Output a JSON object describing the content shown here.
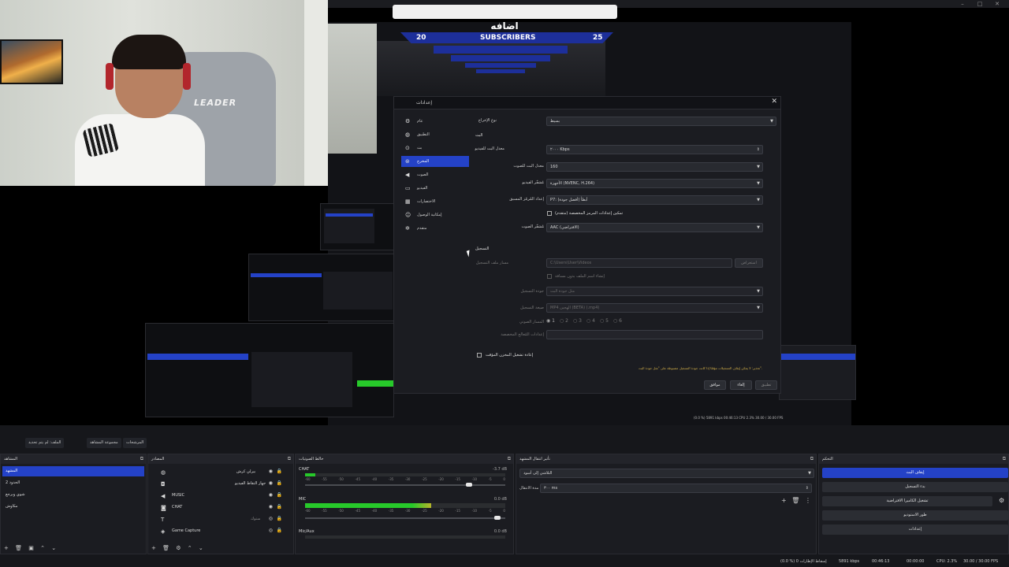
{
  "stream_overlay": {
    "banner_text": "اضافه",
    "count_left": "20",
    "count_right": "25",
    "label": "SUBSCRIBERS"
  },
  "webcam": {
    "chair_logo": "LEADER"
  },
  "settings_dialog": {
    "title": "إعدادات",
    "sidebar": [
      {
        "label": "عام",
        "icon": "gear-icon"
      },
      {
        "label": "التطبيق",
        "icon": "globe-icon"
      },
      {
        "label": "بث",
        "icon": "antenna-icon"
      },
      {
        "label": "المخرج",
        "icon": "output-icon",
        "selected": true
      },
      {
        "label": "الصوت",
        "icon": "speaker-icon"
      },
      {
        "label": "الفيديو",
        "icon": "monitor-icon"
      },
      {
        "label": "الاختصارات",
        "icon": "keyboard-icon"
      },
      {
        "label": "إمكانية الوصول",
        "icon": "accessibility-icon"
      },
      {
        "label": "متقدم",
        "icon": "tools-icon"
      }
    ],
    "output_mode_label": "نوع الإخراج",
    "output_mode_value": "بسيط",
    "streaming_section": "البث",
    "video_bitrate_label": "معدل البت للفيديو",
    "video_bitrate_value": "۲۰۰۰ Kbps",
    "audio_bitrate_label": "معدل البت للصوت",
    "audio_bitrate_value": "160",
    "encoder_label": "مُشفّر الفيديو",
    "encoder_value": "الأجهزة (NVENC, H.264)",
    "preset_label": "إعداد المُرمّز المسبق",
    "preset_value": "P7: أبطأ (أفضل جودة)",
    "custom_encoder_label": "تمكين إعدادات المرمز المخصصة (متقدم)",
    "audio_encoder_label": "مُشفّر الصوت",
    "audio_encoder_value": "AAC (الافتراضي)",
    "recording_section": "التسجيل",
    "recording_path_label": "مسار ملف التسجيل",
    "recording_path_value": "C:\\Users\\User\\Videos",
    "browse_button": "استعراض",
    "no_space_label": "إنشاء اسم الملف بدون مسافة",
    "recording_quality_label": "جودة التسجيل",
    "recording_quality_value": "مثل جودة البث",
    "recording_format_label": "صيغة التسجيل",
    "recording_format_value": "MP4 الهجين (BETA) (.mp4)",
    "audio_track_label": "المسار الصوتي",
    "audio_tracks": [
      "1",
      "2",
      "3",
      "4",
      "5",
      "6"
    ],
    "muxer_label": "إعدادات المُعالج المخصصة",
    "replay_buffer_label": "إعادة تشغيل المخزن المؤقت",
    "warning": "تحذير: لا يمكن إيقاف التسجيلات مؤقتًا إذا كانت جودة التسجيل مضبوطة على \"مثل جودة البث\".",
    "buttons": {
      "ok": "موافق",
      "cancel": "إلغاء",
      "apply": "تطبيق"
    }
  },
  "toolbar": {
    "profile": "الملف: لم يتم تحديد",
    "scene_collection": "مجموعة المشاهد",
    "filters": "المرشحات"
  },
  "scenes_dock": {
    "title": "المشاهد",
    "items": [
      {
        "label": "المشهد",
        "selected": true
      },
      {
        "label": "2 الحدود"
      },
      {
        "label": "شوي وبرجع"
      },
      {
        "label": "مكاوش"
      }
    ]
  },
  "sources_dock": {
    "title": "المصادر",
    "items": [
      {
        "label": "بيرلي كرش",
        "icon": "browser-icon"
      },
      {
        "label": "جهاز التقاط الفيديو",
        "icon": "camera-icon"
      },
      {
        "label": "MUSIC",
        "icon": "music-icon"
      },
      {
        "label": "CHAT",
        "icon": "chat-icon"
      },
      {
        "label": "ستوك",
        "icon": "text-icon"
      },
      {
        "label": "Game Capture",
        "icon": "gamepad-icon"
      }
    ]
  },
  "mixer_dock": {
    "title": "خالط الصوتيات",
    "channels": [
      {
        "name": "CHAT",
        "db": "-3.7 dB",
        "level": 0.05,
        "volume": 0.82
      },
      {
        "name": "MIC",
        "db": "0.0 dB",
        "level": 0.63,
        "volume": 0.96
      },
      {
        "name": "Mic/Aux",
        "db": "0.0 dB",
        "level": 0.0,
        "volume": 0.6
      }
    ],
    "ticks": [
      "-60",
      "-55",
      "-50",
      "-45",
      "-40",
      "-35",
      "-30",
      "-25",
      "-20",
      "-15",
      "-10",
      "-5",
      "0"
    ]
  },
  "transitions_dock": {
    "title": "تأثير انتقال المشهد",
    "transition_value": "التلاشي إلى أسود",
    "duration_label": "مدة الانتقال",
    "duration_value": "۳۰۰ ms"
  },
  "controls_dock": {
    "title": "التحكم",
    "buttons": [
      {
        "label": "إيقاف البث",
        "active": true
      },
      {
        "label": "بدء التسجيل"
      },
      {
        "label": "تشغيل الكاميرا الافتراضية"
      },
      {
        "label": "طور الاستوديو"
      },
      {
        "label": "إعدادات"
      }
    ]
  },
  "status_bar": {
    "dropped": "(0.0 %) إسقاط الإطارات 0",
    "bitrate": "5891 kbps",
    "live_time": "00:46:13",
    "rec_time": "00:00:00",
    "cpu": "CPU: 2.3%",
    "fps": "30.00 / 30.00 FPS"
  }
}
